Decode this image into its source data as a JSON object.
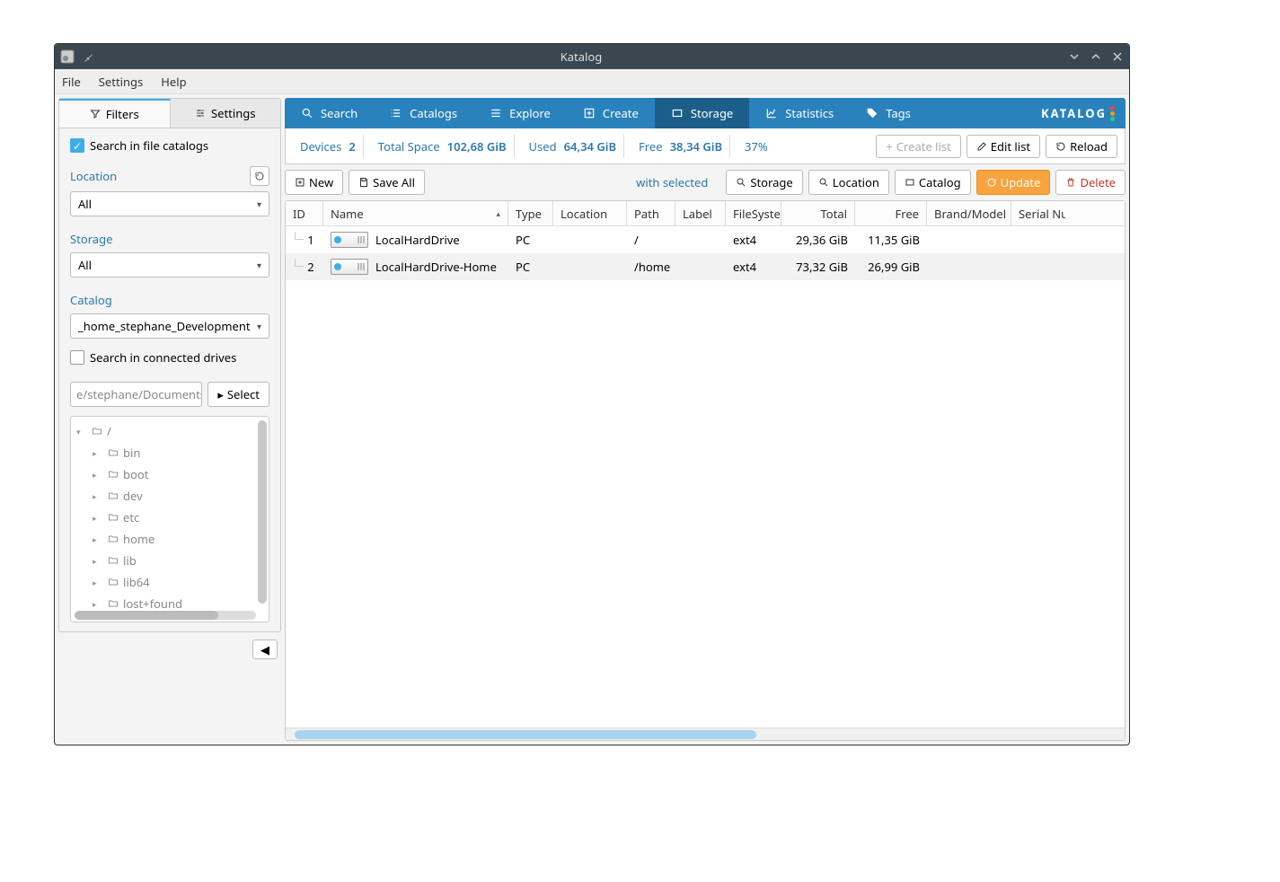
{
  "titlebar": {
    "title": "Katalog"
  },
  "menubar": {
    "file": "File",
    "settings": "Settings",
    "help": "Help"
  },
  "sidetabs": {
    "filters": "Filters",
    "settings": "Settings"
  },
  "filters": {
    "search_catalogs_label": "Search in file catalogs",
    "location_label": "Location",
    "location_value": "All",
    "storage_label": "Storage",
    "storage_value": "All",
    "catalog_label": "Catalog",
    "catalog_value": "_home_stephane_Development",
    "search_drives_label": "Search in connected drives",
    "path_input": "e/stephane/Documents",
    "select_btn": "Select"
  },
  "tree": {
    "root": "/",
    "children": [
      "bin",
      "boot",
      "dev",
      "etc",
      "home",
      "lib",
      "lib64",
      "lost+found"
    ]
  },
  "maintabs": {
    "search": "Search",
    "catalogs": "Catalogs",
    "explore": "Explore",
    "create": "Create",
    "storage": "Storage",
    "statistics": "Statistics",
    "tags": "Tags",
    "brand": "KATALOG"
  },
  "stats": {
    "devices_label": "Devices",
    "devices_value": "2",
    "total_label": "Total Space",
    "total_value": "102,68 GiB",
    "used_label": "Used",
    "used_value": "64,34 GiB",
    "free_label": "Free",
    "free_value": "38,34 GiB",
    "percent": "37%",
    "create_list": "Create list",
    "edit_list": "Edit list",
    "reload": "Reload"
  },
  "toolbar": {
    "new": "New",
    "save_all": "Save All",
    "with_selected": "with selected",
    "storage": "Storage",
    "location": "Location",
    "catalog": "Catalog",
    "update": "Update",
    "delete": "Delete"
  },
  "table": {
    "headers": {
      "id": "ID",
      "name": "Name",
      "type": "Type",
      "location": "Location",
      "path": "Path",
      "label": "Label",
      "fs": "FileSystem",
      "total": "Total",
      "free": "Free",
      "brand": "Brand/Model",
      "serial": "Serial Nur"
    },
    "rows": [
      {
        "id": "1",
        "name": "LocalHardDrive",
        "type": "PC",
        "location": "",
        "path": "/",
        "label": "",
        "fs": "ext4",
        "total": "29,36 GiB",
        "free": "11,35 GiB"
      },
      {
        "id": "2",
        "name": "LocalHardDrive-Home",
        "type": "PC",
        "location": "",
        "path": "/home",
        "label": "",
        "fs": "ext4",
        "total": "73,32 GiB",
        "free": "26,99 GiB"
      }
    ]
  }
}
